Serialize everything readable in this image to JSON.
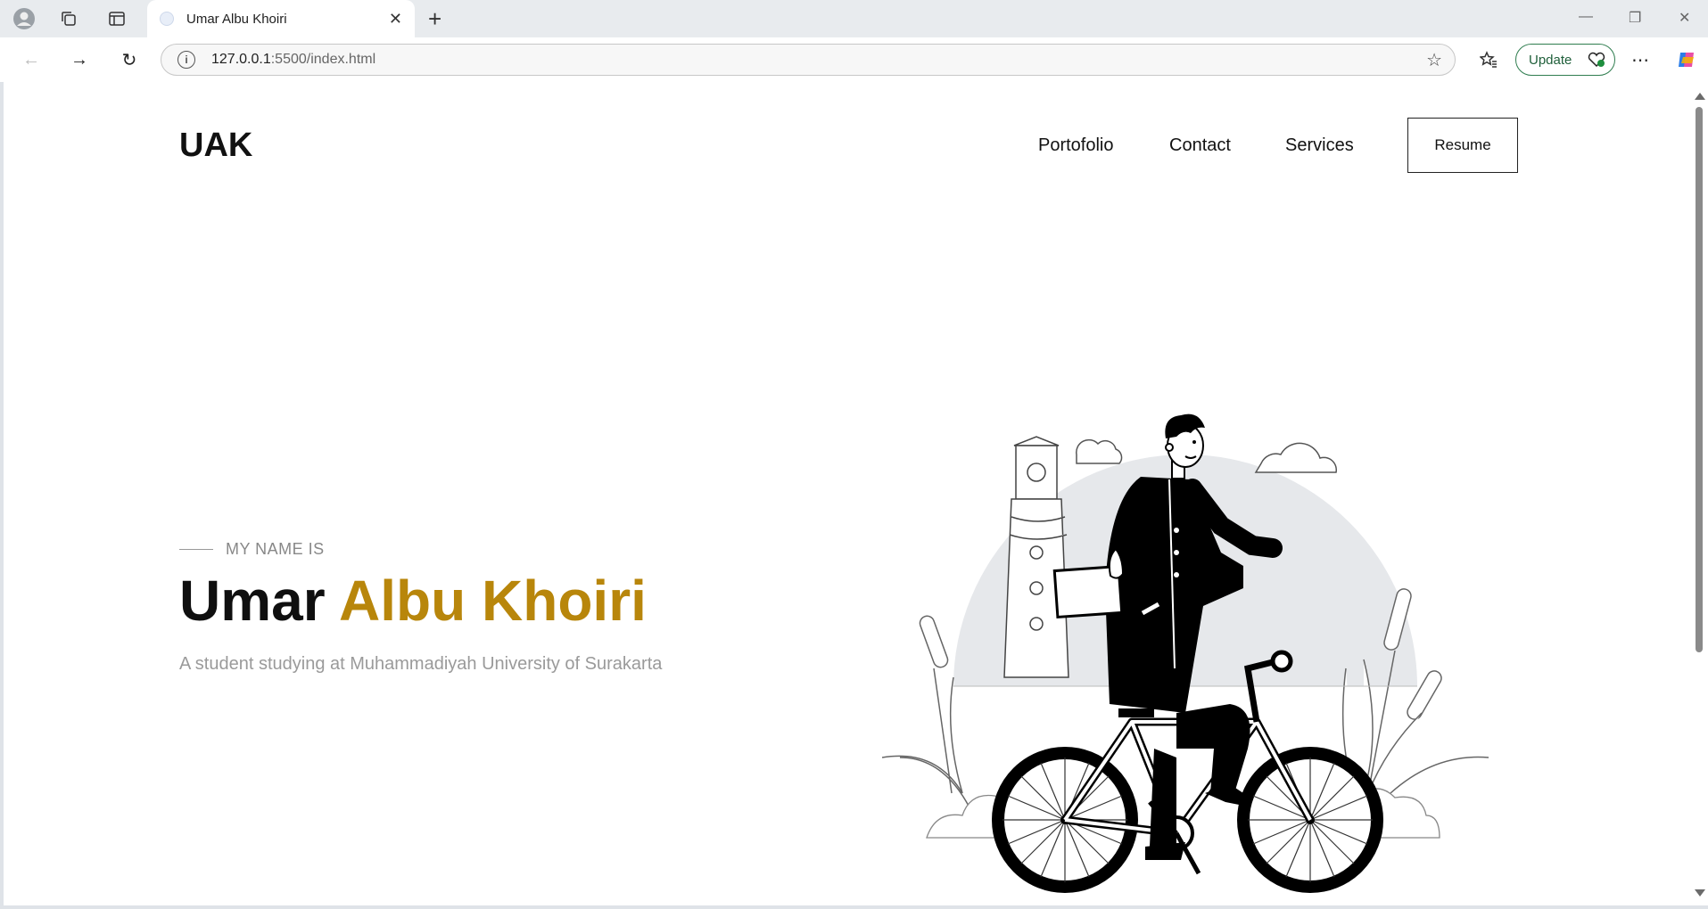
{
  "browser": {
    "tab_title": "Umar Albu Khoiri",
    "url_host": "127.0.0.1",
    "url_path": ":5500/index.html",
    "update_label": "Update"
  },
  "site": {
    "logo": "UAK",
    "nav": [
      "Portofolio",
      "Contact",
      "Services"
    ],
    "resume_label": "Resume"
  },
  "hero": {
    "kicker": "MY NAME IS",
    "first_name": "Umar",
    "rest_name": "Albu Khoiri",
    "description": "A student studying at Muhammadiyah University of Surakarta",
    "accent_color": "#b8860b"
  }
}
